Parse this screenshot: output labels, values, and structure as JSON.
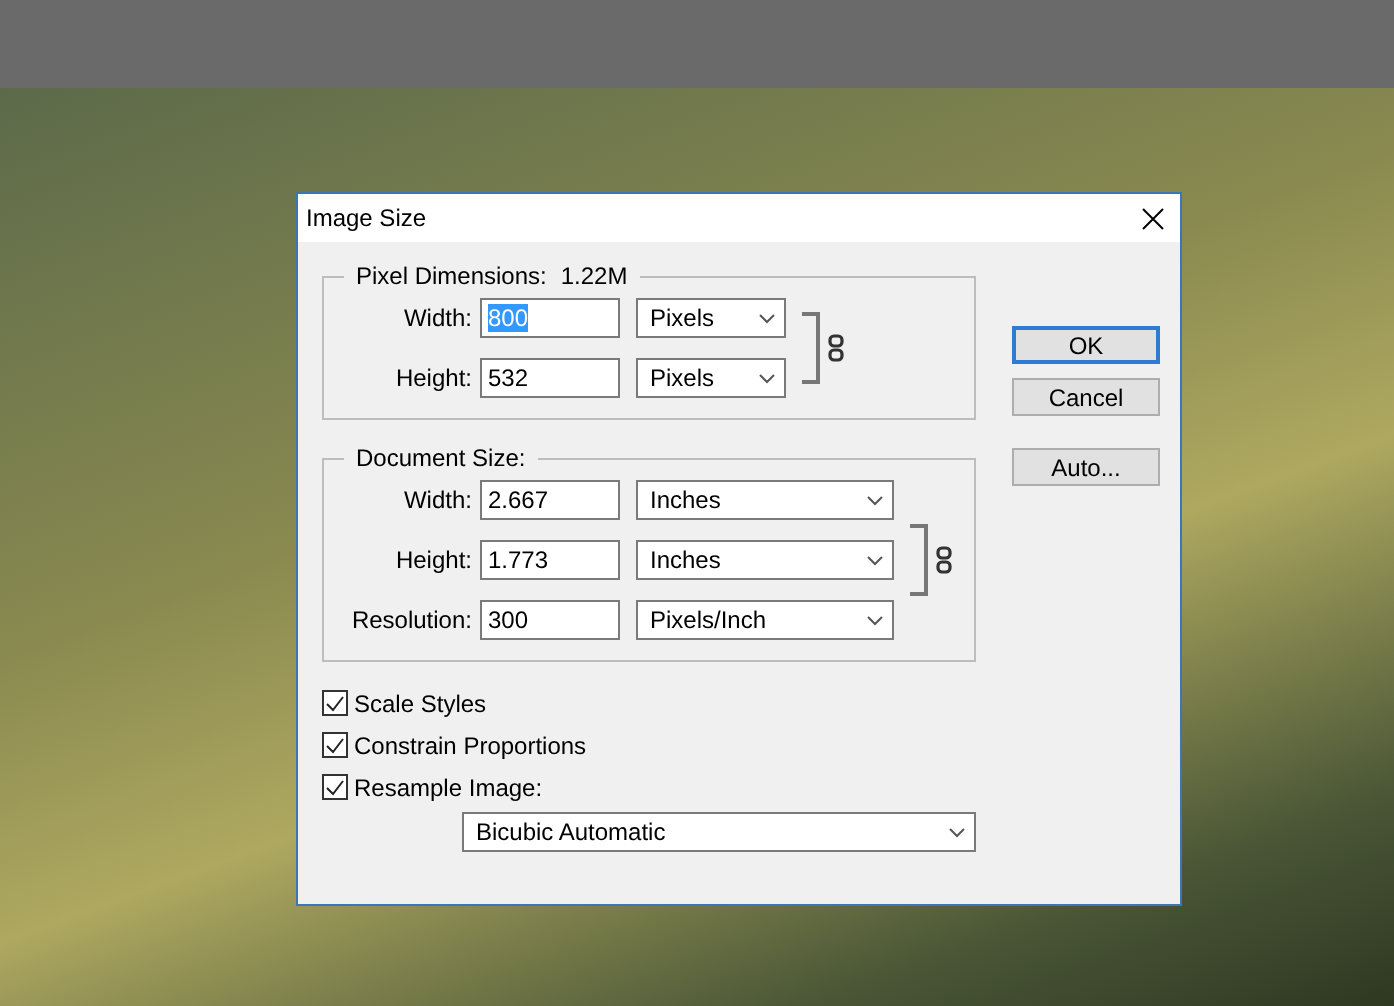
{
  "window": {
    "title": "Image Size"
  },
  "pixel_dimensions": {
    "label": "Pixel Dimensions:",
    "value": "1.22M",
    "linked": true,
    "rows": [
      {
        "label": "Width:",
        "value": "800",
        "text_selected": true,
        "unit": "Pixels"
      },
      {
        "label": "Height:",
        "value": "532",
        "text_selected": false,
        "unit": "Pixels"
      }
    ]
  },
  "document_size": {
    "label": "Document Size:",
    "linked": true,
    "rows": [
      {
        "label": "Width:",
        "value": "2.667",
        "text_selected": false,
        "unit": "Inches"
      },
      {
        "label": "Height:",
        "value": "1.773",
        "text_selected": false,
        "unit": "Inches"
      },
      {
        "label": "Resolution:",
        "value": "300",
        "text_selected": false,
        "unit": "Pixels/Inch"
      }
    ]
  },
  "options": [
    {
      "label": "Scale Styles",
      "checked": true
    },
    {
      "label": "Constrain Proportions",
      "checked": true
    },
    {
      "label": "Resample Image:",
      "checked": true
    }
  ],
  "resample_method": "Bicubic Automatic",
  "buttons": [
    {
      "label": "OK",
      "focused": true
    },
    {
      "label": "Cancel",
      "focused": false
    },
    {
      "label": "Auto...",
      "focused": false
    }
  ]
}
